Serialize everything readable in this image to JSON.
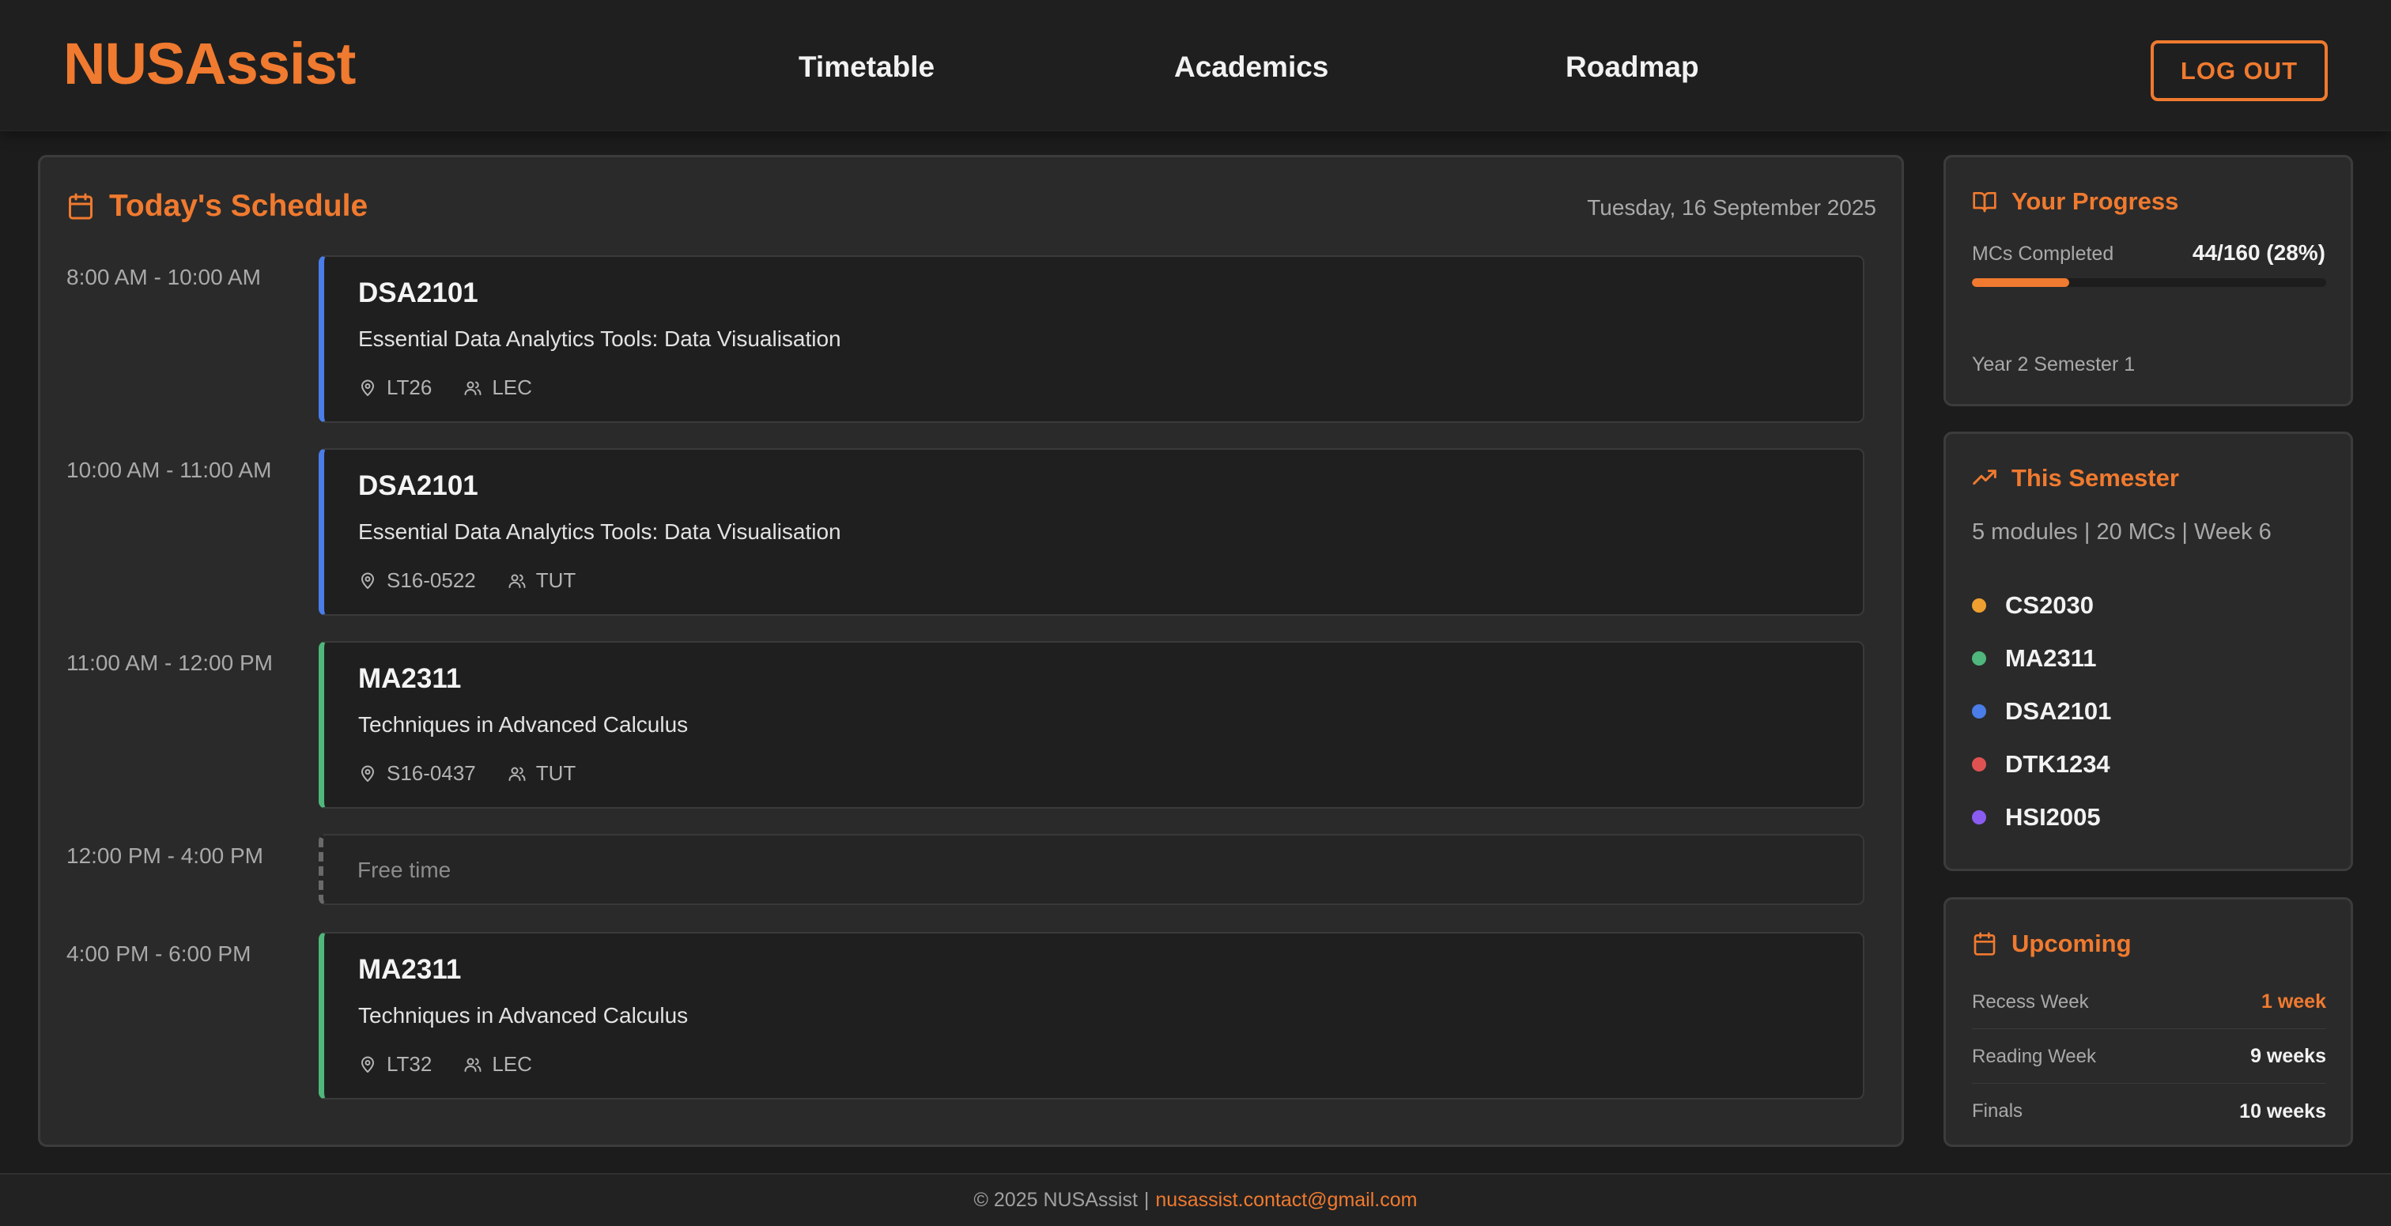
{
  "header": {
    "logo": "NUSAssist",
    "nav": [
      "Timetable",
      "Academics",
      "Roadmap"
    ],
    "logout_label": "LOG OUT"
  },
  "schedule": {
    "title": "Today's Schedule",
    "date": "Tuesday, 16 September 2025",
    "slots": [
      {
        "time": "8:00 AM - 10:00 AM",
        "code": "DSA2101",
        "name": "Essential Data Analytics Tools: Data Visualisation",
        "venue": "LT26",
        "type": "LEC",
        "color": "#4a7de8"
      },
      {
        "time": "10:00 AM - 11:00 AM",
        "code": "DSA2101",
        "name": "Essential Data Analytics Tools: Data Visualisation",
        "venue": "S16-0522",
        "type": "TUT",
        "color": "#4a7de8"
      },
      {
        "time": "11:00 AM - 12:00 PM",
        "code": "MA2311",
        "name": "Techniques in Advanced Calculus",
        "venue": "S16-0437",
        "type": "TUT",
        "color": "#4fb67c"
      },
      {
        "time": "12:00 PM - 4:00 PM",
        "free_label": "Free time"
      },
      {
        "time": "4:00 PM - 6:00 PM",
        "code": "MA2311",
        "name": "Techniques in Advanced Calculus",
        "venue": "LT32",
        "type": "LEC",
        "color": "#4fb67c"
      }
    ]
  },
  "progress": {
    "title": "Your Progress",
    "mc_label": "MCs Completed",
    "mc_value": "44/160 (28%)",
    "mc_fraction": 0.275,
    "year_semester": "Year 2 Semester 1"
  },
  "semester": {
    "title": "This Semester",
    "summary": "5 modules | 20 MCs | Week 6",
    "modules": [
      {
        "code": "CS2030",
        "color": "#f0a030"
      },
      {
        "code": "MA2311",
        "color": "#4fb67c"
      },
      {
        "code": "DSA2101",
        "color": "#4a7de8"
      },
      {
        "code": "DTK1234",
        "color": "#e05252"
      },
      {
        "code": "HSI2005",
        "color": "#8a5cf0"
      }
    ]
  },
  "upcoming": {
    "title": "Upcoming",
    "items": [
      {
        "label": "Recess Week",
        "value": "1 week"
      },
      {
        "label": "Reading Week",
        "value": "9 weeks"
      },
      {
        "label": "Finals",
        "value": "10 weeks"
      }
    ]
  },
  "footer": {
    "copyright": "© 2025 NUSAssist",
    "separator": "|",
    "email": "nusassist.contact@gmail.com"
  },
  "colors": {
    "accent": "#f07a2f",
    "background": "#1c1c1c",
    "panel": "#2a2a2a"
  }
}
